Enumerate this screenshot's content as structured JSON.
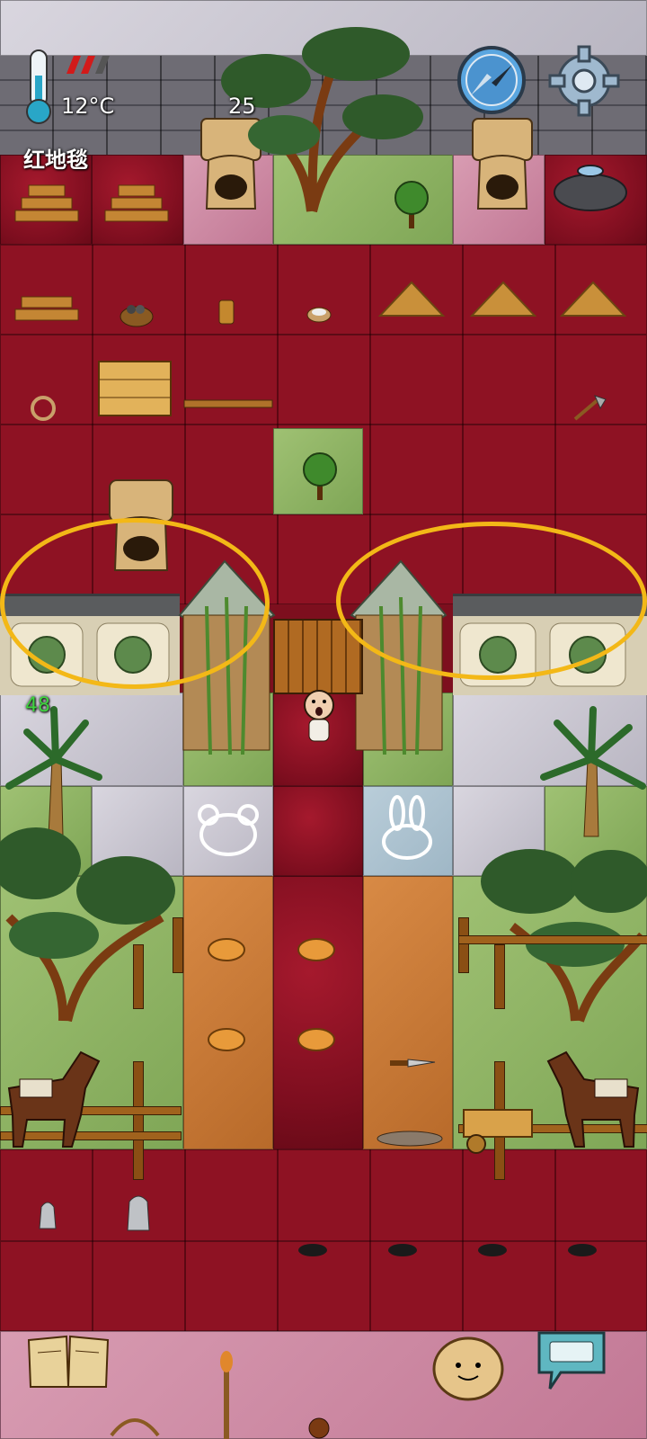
{
  "hud": {
    "temperature": "12°C",
    "counter": "25",
    "location_name": "红地毯",
    "side_number": "48",
    "icons": {
      "thermometer": "thermometer-icon",
      "hunger": "hunger-bars-icon",
      "compass": "compass-icon",
      "settings": "gear-icon",
      "recipe_book": "book-icon",
      "emote": "emote-face-icon",
      "chat": "keyboard-chat-icon"
    }
  },
  "colors": {
    "carpet_red": "#a5192d",
    "annotation_yellow": "#f3b817",
    "side_number_green": "#3fd33f"
  }
}
